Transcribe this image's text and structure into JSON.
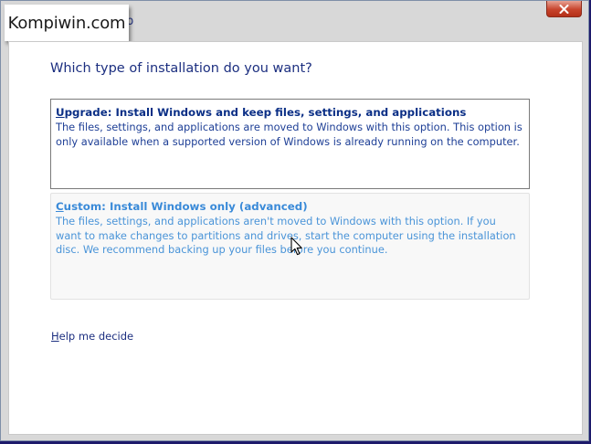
{
  "window": {
    "title_fragment": "p"
  },
  "watermark": {
    "text": "Kompiwin.com"
  },
  "page": {
    "question": "Which type of installation do you want?"
  },
  "options": [
    {
      "title_first": "U",
      "title_rest": "pgrade: Install Windows and keep files, settings, and applications",
      "description": "The files, settings, and applications are moved to Windows with this option. This option is only available when a supported version of Windows is already running on the computer."
    },
    {
      "title_first": "C",
      "title_rest": "ustom: Install Windows only (advanced)",
      "description": "The files, settings, and applications aren't moved to Windows with this option. If you want to make changes to partitions and drives, start the computer using the installation disc. We recommend backing up your files before you continue."
    }
  ],
  "help": {
    "first": "H",
    "rest": "elp me decide"
  },
  "icons": {
    "close": "close-icon",
    "cursor": "mouse-pointer-icon"
  },
  "colors": {
    "background": "#1d1a6b",
    "window_chrome": "#d8d8d8",
    "heading_blue": "#1c2f80",
    "hover_blue": "#3a8ad8",
    "close_red": "#c7442c"
  }
}
